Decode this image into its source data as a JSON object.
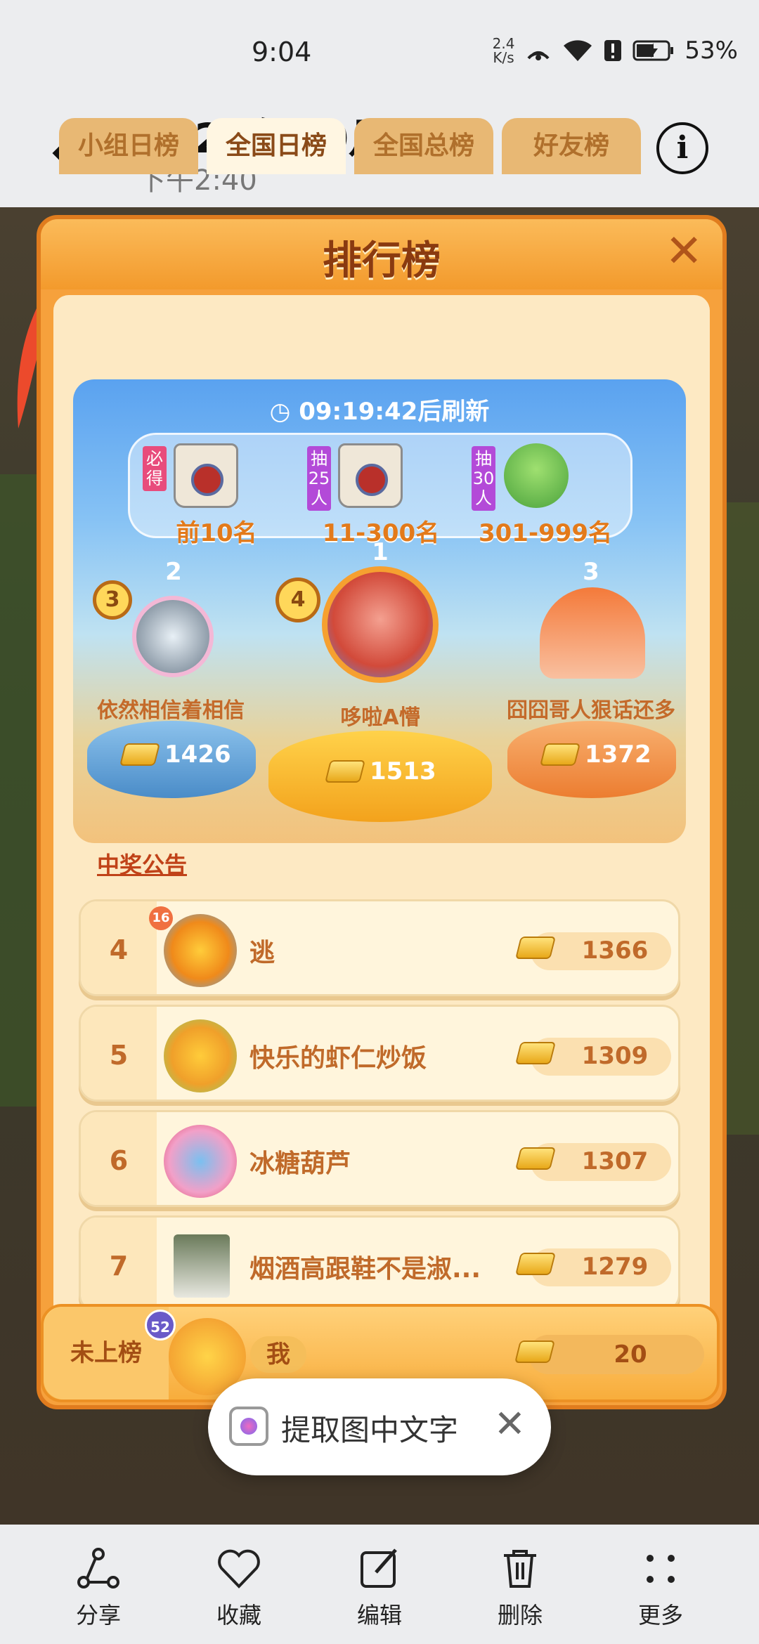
{
  "status_bar": {
    "time": "9:04",
    "net_speed_value": "2.4",
    "net_speed_unit": "K/s",
    "battery": "53%"
  },
  "header": {
    "title": "2023年10月3日",
    "subtitle": "下午2:40"
  },
  "game": {
    "panel_title": "排行榜",
    "tabs": [
      {
        "label": "小组日榜",
        "active": false
      },
      {
        "label": "全国日榜",
        "active": true
      },
      {
        "label": "全国总榜",
        "active": false
      },
      {
        "label": "好友榜",
        "active": false
      }
    ],
    "refresh_text": "09:19:42后刷新",
    "prizes": [
      {
        "tag": "必得",
        "label": "前10名"
      },
      {
        "tag": "抽25人",
        "label": "11-300名"
      },
      {
        "tag": "抽30人",
        "label": "301-999名"
      }
    ],
    "podium": [
      {
        "rank": "2",
        "badge": "3",
        "name": "依然相信着相信",
        "score": "1426"
      },
      {
        "rank": "1",
        "badge": "4",
        "name": "哆啦A懵",
        "score": "1513"
      },
      {
        "rank": "3",
        "name": "囧囧哥人狠话还多",
        "score": "1372"
      }
    ],
    "notice": "中奖公告",
    "rows": [
      {
        "rank": "4",
        "level": "16",
        "name": "逃",
        "score": "1366"
      },
      {
        "rank": "5",
        "name": "快乐的虾仁炒饭",
        "score": "1309"
      },
      {
        "rank": "6",
        "name": "冰糖葫芦",
        "score": "1307"
      },
      {
        "rank": "7",
        "name": "烟酒高跟鞋不是淑...",
        "score": "1279"
      }
    ],
    "my_row": {
      "label": "未上榜",
      "level": "52",
      "name": "我",
      "score": "20"
    }
  },
  "ocr_popup": {
    "label": "提取图中文字"
  },
  "toolbar": {
    "share": "分享",
    "favorite": "收藏",
    "edit": "编辑",
    "delete": "删除",
    "more": "更多"
  }
}
